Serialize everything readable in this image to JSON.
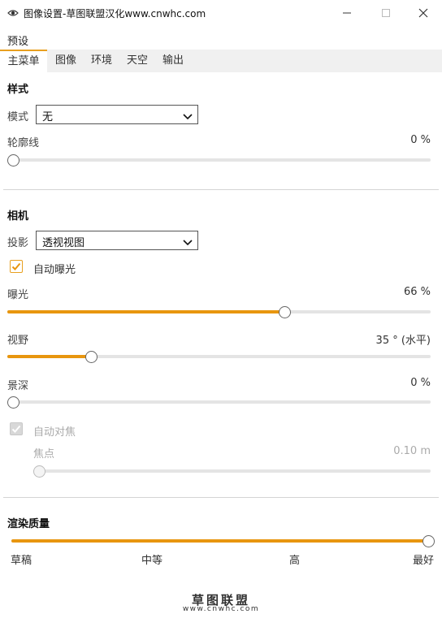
{
  "window": {
    "title": "图像设置-草图联盟汉化www.cnwhc.com",
    "icon": "eye-icon"
  },
  "menu": {
    "preset": "预设"
  },
  "tabs": [
    "主菜单",
    "图像",
    "环境",
    "天空",
    "输出"
  ],
  "style_section": {
    "title": "样式",
    "mode_label": "模式",
    "mode_value": "无",
    "outline_label": "轮廓线",
    "outline_value": "0 %",
    "outline_level": 0
  },
  "camera_section": {
    "title": "相机",
    "projection_label": "投影",
    "projection_value": "透视视图",
    "auto_exposure_label": "自动曝光",
    "auto_exposure_checked": true,
    "exposure_label": "曝光",
    "exposure_value": "66 %",
    "exposure_level": 0.66,
    "fov_label": "视野",
    "fov_value": "35 ° (水平)",
    "fov_level": 0.19,
    "dof_label": "景深",
    "dof_value": "0 %",
    "dof_level": 0,
    "auto_focus_label": "自动对焦",
    "auto_focus_checked": true,
    "focus_label": "焦点",
    "focus_value": "0.10 m",
    "focus_level": 0
  },
  "quality_section": {
    "title": "渲染质量",
    "level": 1.0,
    "labels": [
      "草稿",
      "中等",
      "高",
      "最好"
    ]
  },
  "watermark": {
    "name": "草图联盟",
    "url": "www.cnwhc.com"
  },
  "colors": {
    "accent": "#e8960f",
    "track": "#e4e4e4"
  }
}
